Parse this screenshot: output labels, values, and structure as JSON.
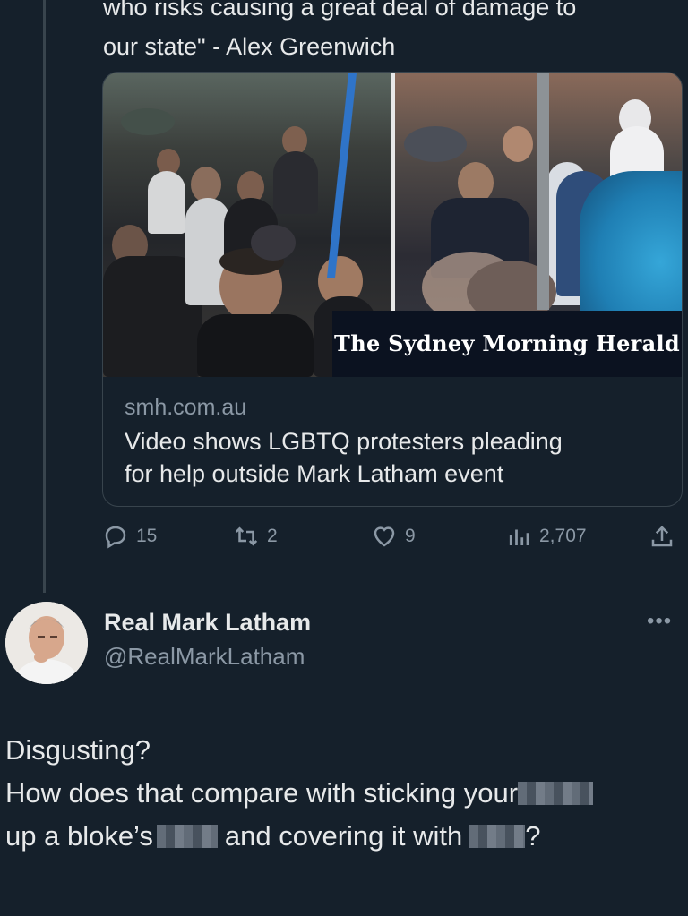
{
  "quoted_text": {
    "line1": "who risks causing a great deal of damage to",
    "line2": "our state\" - Alex Greenwich"
  },
  "link_card": {
    "masthead": "The Sydney Morning Herald",
    "domain": "smh.com.au",
    "title_line1": "Video shows LGBTQ protesters pleading",
    "title_line2": "for help outside Mark Latham event"
  },
  "actions": {
    "replies": "15",
    "retweets": "2",
    "likes": "9",
    "views": "2,707"
  },
  "tweet": {
    "author_name": "Real Mark Latham",
    "author_handle": "@RealMarkLatham",
    "more_label": "•••",
    "line1": "Disgusting?",
    "line2_a": "How does that compare with sticking your",
    "line3_a": "up a bloke’s",
    "line3_b": "and covering it with",
    "line3_c": "?"
  },
  "colors": {
    "background": "#15202b",
    "text_primary": "#e7e9ea",
    "text_secondary": "#8b98a5",
    "border": "#38444d"
  }
}
